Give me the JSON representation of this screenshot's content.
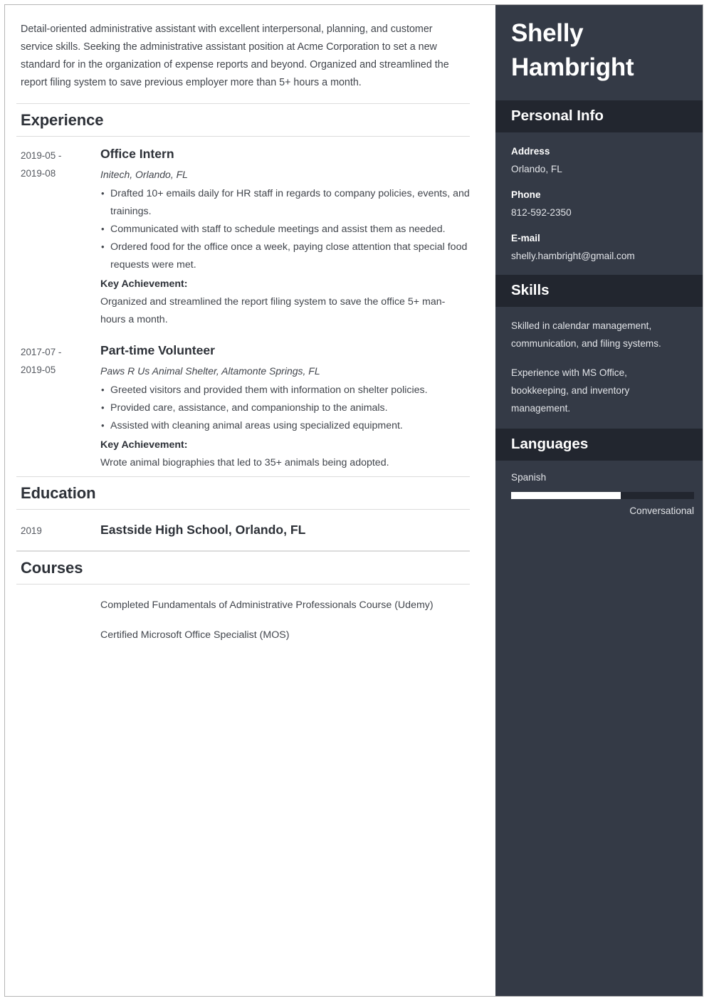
{
  "summary": "Detail-oriented administrative assistant with excellent interpersonal, planning, and customer service skills. Seeking the administrative assistant position at Acme Corporation to set a new standard for in the organization of expense reports and beyond. Organized and streamlined the report filing system to save previous employer more than 5+ hours a month.",
  "sections": {
    "experience_title": "Experience",
    "education_title": "Education",
    "courses_title": "Courses"
  },
  "experience": [
    {
      "date_start": "2019-05 -",
      "date_end": "2019-08",
      "title": "Office Intern",
      "organization": "Initech, Orlando, FL",
      "duties": [
        "Drafted 10+ emails daily for HR staff in regards to company policies, events, and trainings.",
        "Communicated with staff to schedule meetings and assist them as needed.",
        "Ordered food for the office once a week, paying close attention that special food requests were met."
      ],
      "achievement_label": "Key Achievement:",
      "achievement_text": "Organized and streamlined the report filing system to save the office 5+ man-hours a month."
    },
    {
      "date_start": "2017-07 -",
      "date_end": "2019-05",
      "title": "Part-time Volunteer",
      "organization": "Paws R Us Animal Shelter, Altamonte Springs, FL",
      "duties": [
        "Greeted visitors and provided them with information on shelter policies.",
        "Provided care, assistance, and companionship to the animals.",
        "Assisted with cleaning animal areas using specialized equipment."
      ],
      "achievement_label": "Key Achievement:",
      "achievement_text": "Wrote animal biographies that led to 35+ animals being adopted."
    }
  ],
  "education": [
    {
      "year": "2019",
      "school": "Eastside High School, Orlando, FL"
    }
  ],
  "courses": [
    {
      "text": "Completed Fundamentals of Administrative Professionals Course (Udemy)"
    },
    {
      "text": "Certified Microsoft Office Specialist (MOS)"
    }
  ],
  "sidebar": {
    "name_first": "Shelly",
    "name_last": "Hambright",
    "personal_info": {
      "heading": "Personal Info",
      "address_label": "Address",
      "address_value": "Orlando, FL",
      "phone_label": "Phone",
      "phone_value": "812-592-2350",
      "email_label": "E-mail",
      "email_value": "shelly.hambright@gmail.com"
    },
    "skills": {
      "heading": "Skills",
      "items": [
        "Skilled in calendar management, communication, and filing systems.",
        "Experience with MS Office, bookkeeping, and inventory management."
      ]
    },
    "languages": {
      "heading": "Languages",
      "items": [
        {
          "name": "Spanish",
          "level": "Conversational",
          "percent": 60
        }
      ]
    }
  },
  "colors": {
    "sidebar_bg": "#343a46",
    "sidebar_header_bg": "#22262f",
    "paper_bg": "#ffffff",
    "body_text": "#41454c",
    "heading_text": "#2d3138",
    "rule": "#dcdcdc"
  }
}
